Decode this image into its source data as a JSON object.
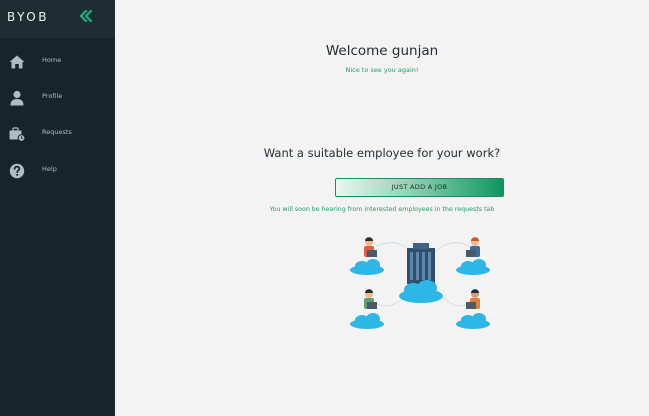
{
  "sidebar": {
    "brand": "BYOB",
    "items": [
      {
        "label": "Home",
        "icon": "home-icon"
      },
      {
        "label": "Profile",
        "icon": "profile-icon"
      },
      {
        "label": "Requests",
        "icon": "requests-icon"
      },
      {
        "label": "Help",
        "icon": "help-icon"
      }
    ]
  },
  "main": {
    "welcome_title": "Welcome gunjan",
    "welcome_subtitle": "Nice to see you again!",
    "question": "Want a suitable employee for your work?",
    "cta_label": "JUST ADD A JOB",
    "hint": "You will soon be hearing from interested employees in the requests tab"
  },
  "colors": {
    "sidebar_bg": "#16252a",
    "accent_green": "#22a06b",
    "collapse_icon": "#1fb27a",
    "page_bg": "#f3f3f3"
  }
}
